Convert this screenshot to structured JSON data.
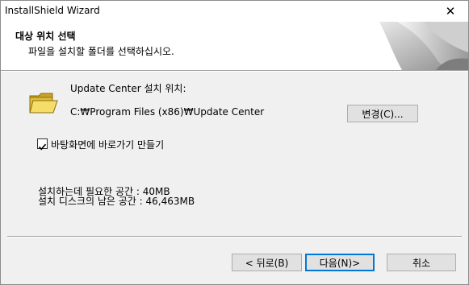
{
  "window": {
    "title": "InstallShield Wizard",
    "close_glyph": "✕"
  },
  "header": {
    "title": "대상 위치 선택",
    "subtitle": "파일을 설치할 폴더를 선택하십시오."
  },
  "destination": {
    "label": "Update Center 설치 위치:",
    "path": "C:₩Program Files (x86)₩Update Center",
    "change_button": "변경(C)...",
    "icon": "folder-icon"
  },
  "shortcut": {
    "label": "바탕화면에 바로가기 만들기",
    "checked": true
  },
  "space": {
    "required": "설치하는데 필요한 공간 : 40MB",
    "available": "설치 디스크의 남은 공간 : 46,463MB"
  },
  "buttons": {
    "back": "< 뒤로(B)",
    "next": "다음(N)>",
    "cancel": "취소"
  }
}
